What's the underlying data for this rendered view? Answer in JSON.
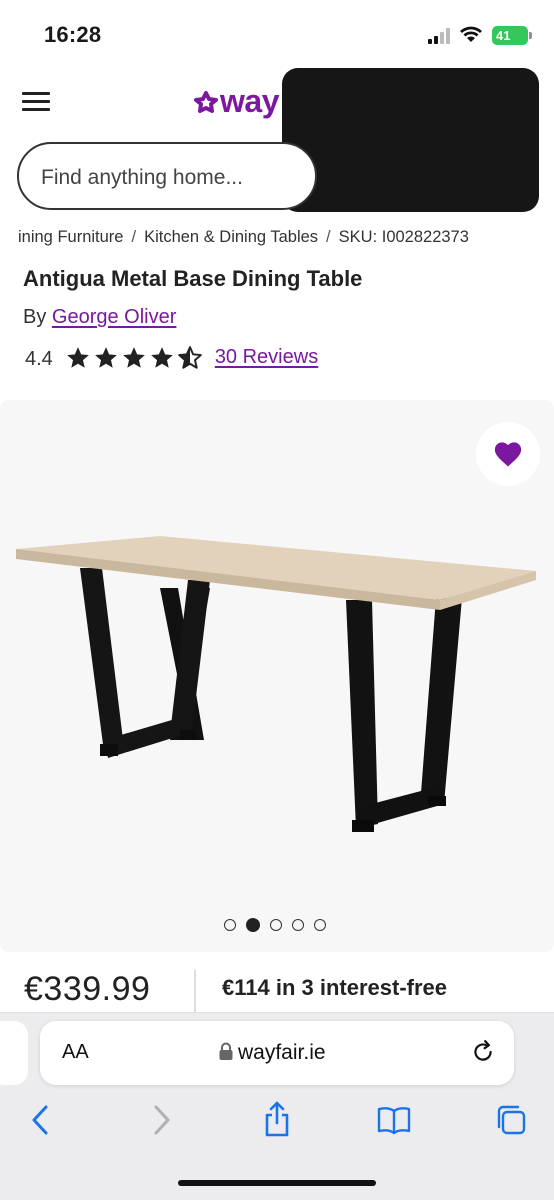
{
  "status_bar": {
    "time": "16:28",
    "battery": "41"
  },
  "header": {
    "logo": "way"
  },
  "search": {
    "placeholder": "Find anything home..."
  },
  "breadcrumbs": [
    "ining Furniture",
    "Kitchen & Dining Tables",
    "SKU: I002822373"
  ],
  "product": {
    "title": "Antigua Metal Base Dining Table",
    "by_label": "By",
    "brand": "George Oliver",
    "rating": "4.4",
    "rating_value": 4.4,
    "rating_max": 5,
    "reviews": "30 Reviews",
    "price": "€339.99",
    "finance": "€114 in 3 interest-free"
  },
  "gallery": {
    "image_count": 5,
    "active_index": 1
  },
  "browser": {
    "aa": "AA",
    "url": "wayfair.ie"
  },
  "colors": {
    "brand": "#7b189f",
    "battery": "#34c759",
    "browser_accent": "#1a73e8"
  }
}
